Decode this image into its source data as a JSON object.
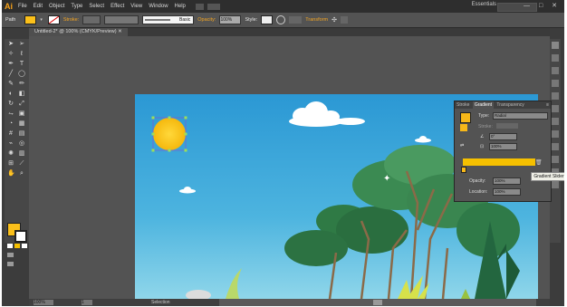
{
  "app": {
    "logo": "Ai",
    "menu": [
      "File",
      "Edit",
      "Object",
      "Type",
      "Select",
      "Effect",
      "View",
      "Window",
      "Help"
    ],
    "workspace": "Essentials",
    "window_buttons": "—  □  ✕"
  },
  "control_bar": {
    "selection": "Path",
    "stroke_label": "Stroke:",
    "brush": "Basic",
    "opacity_label": "Opacity:",
    "opacity_value": "100%",
    "style_label": "Style:",
    "transform_label": "Transform"
  },
  "document": {
    "tab_title": "Untitled-2* @ 100% (CMYK/Preview)"
  },
  "colors": {
    "fill": "#fbc01a",
    "accent": "#f7a21b",
    "sky": "#2c9bd5",
    "gradient": "#f5c000"
  },
  "gradient_panel": {
    "tabs": [
      "Stroke",
      "Gradient",
      "Transparency"
    ],
    "active_tab": "Gradient",
    "type_label": "Type:",
    "type_value": "Radial",
    "stroke_label": "Stroke:",
    "angle_value": "0°",
    "aspect_value": "100%",
    "opacity_label": "Opacity:",
    "opacity_value": "100%",
    "location_label": "Location:",
    "location_value": "100%",
    "tooltip": "Gradient Slider"
  },
  "status": {
    "zoom": "100%",
    "page": "1",
    "tool": "Selection"
  }
}
